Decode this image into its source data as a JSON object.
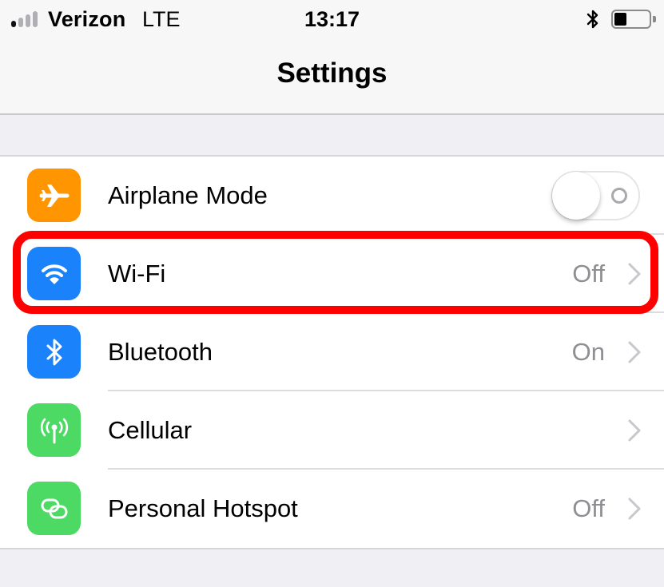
{
  "status_bar": {
    "carrier": "Verizon",
    "network": "LTE",
    "time": "13:17",
    "signal_bars_filled": 1,
    "signal_bars_total": 4,
    "bluetooth_icon": "bluetooth-icon",
    "battery_level_fraction": 0.35
  },
  "nav": {
    "title": "Settings"
  },
  "colors": {
    "orange": "#ff9500",
    "blue": "#1a82fb",
    "green": "#4cd964",
    "highlight": "#ff0000",
    "secondary_text": "#8e8e93"
  },
  "rows": [
    {
      "label": "Airplane Mode",
      "icon": "airplane-icon",
      "control": "toggle",
      "toggle_on": false
    },
    {
      "label": "Wi-Fi",
      "icon": "wifi-icon",
      "value": "Off",
      "control": "disclosure",
      "highlighted": true
    },
    {
      "label": "Bluetooth",
      "icon": "bluetooth-icon",
      "value": "On",
      "control": "disclosure"
    },
    {
      "label": "Cellular",
      "icon": "cellular-icon",
      "value": "",
      "control": "disclosure"
    },
    {
      "label": "Personal Hotspot",
      "icon": "hotspot-icon",
      "value": "Off",
      "control": "disclosure"
    }
  ]
}
